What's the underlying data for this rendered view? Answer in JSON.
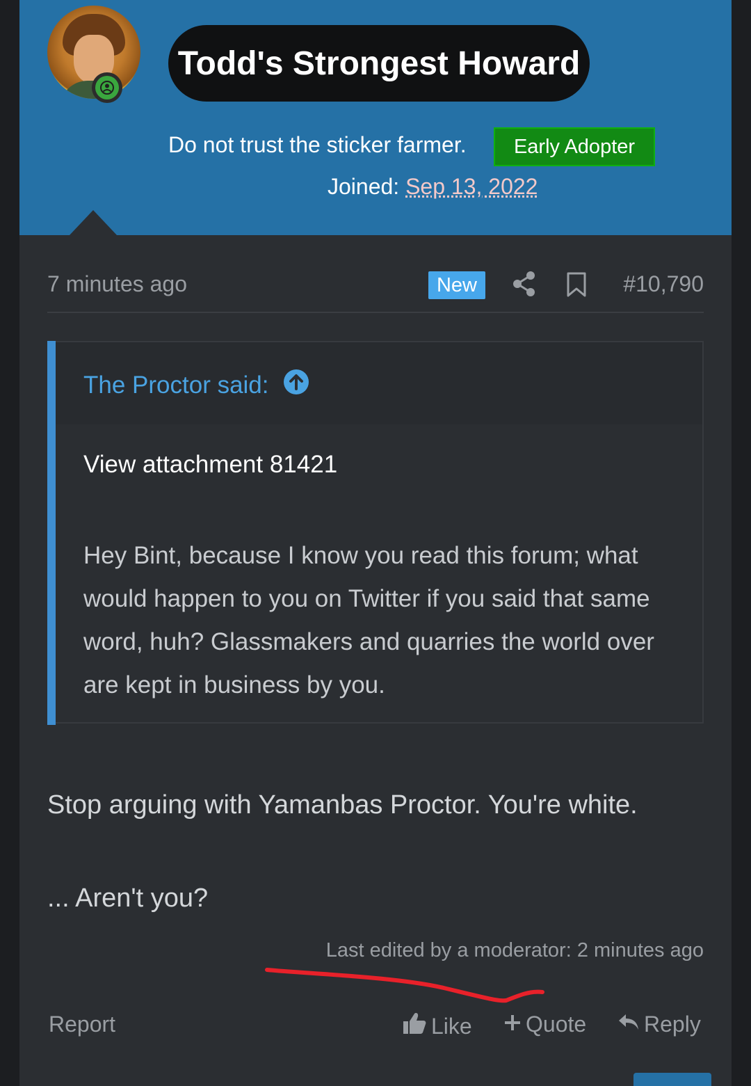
{
  "user": {
    "name": "Todd's Strongest Howard",
    "tagline": "Do not trust the sticker farmer.",
    "badge": "Early Adopter",
    "joined_label": "Joined:",
    "joined_date": "Sep 13, 2022"
  },
  "post": {
    "timestamp": "7 minutes ago",
    "new_label": "New",
    "number": "#10,790",
    "quote": {
      "author": "The Proctor said:",
      "attachment": "View attachment 81421",
      "body": "Hey Bint, because I know you read this forum; what would happen to you on Twitter if you said that same word, huh? Glassmakers and quarries the world over are kept in business by you."
    },
    "message_line1": "Stop arguing with Yamanbas Proctor. You're white.",
    "message_line2": "... Aren't you?",
    "edited": "Last edited by a moderator: 2 minutes ago"
  },
  "actions": {
    "report": "Report",
    "like": "Like",
    "quote": "Quote",
    "reply": "Reply"
  },
  "colors": {
    "header_bg": "#2571a6",
    "post_bg": "#2b2e32",
    "accent_blue": "#4aa3e2",
    "badge_green": "#128a14",
    "annotation_red": "#e8212a"
  },
  "icons": [
    "user-icon",
    "share-icon",
    "bookmark-icon",
    "arrow-up-circle-icon",
    "thumbs-up-icon",
    "plus-icon",
    "reply-icon"
  ]
}
